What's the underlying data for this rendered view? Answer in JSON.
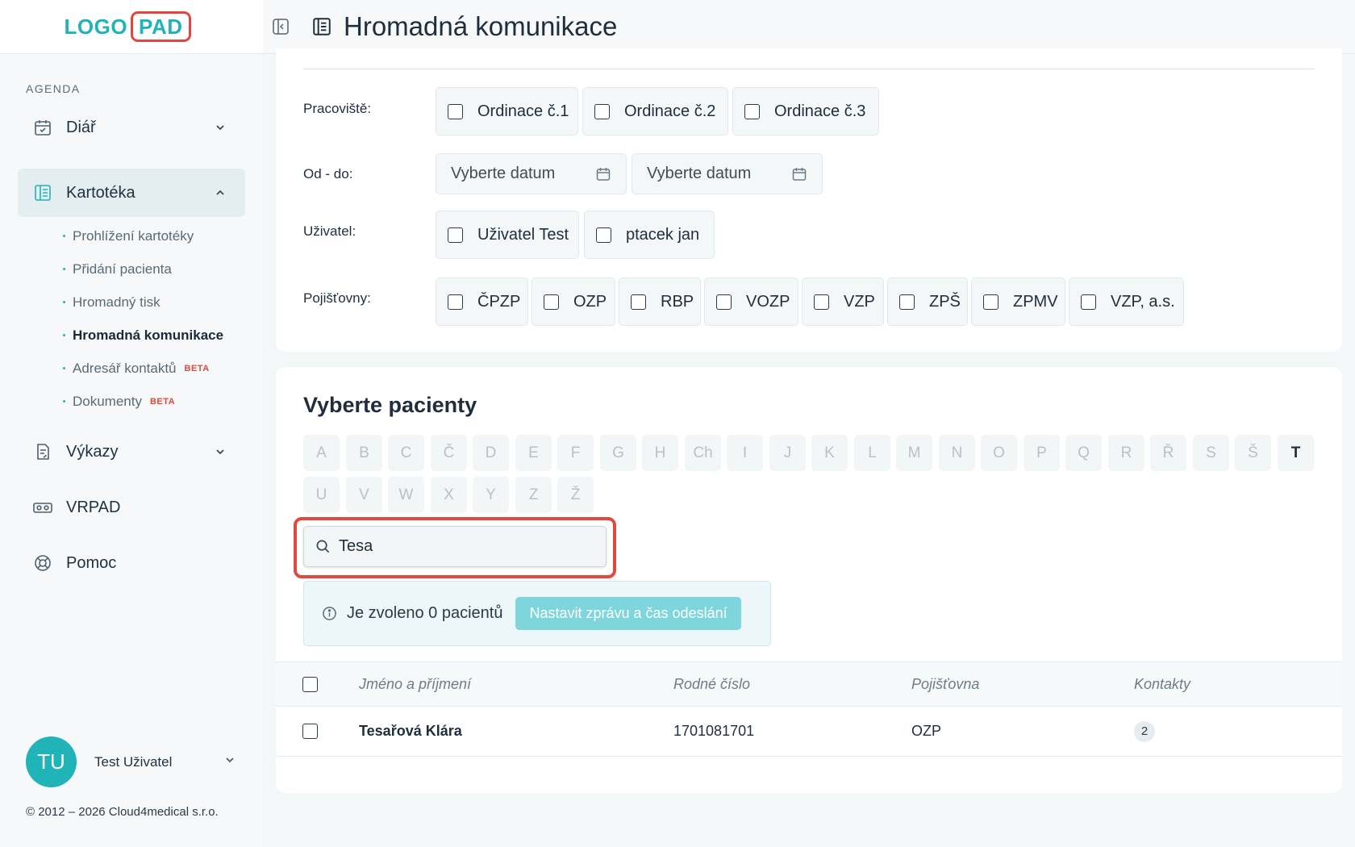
{
  "sidebar": {
    "logo": {
      "part_a": "LOGO",
      "part_b": "PAD"
    },
    "section_label": "AGENDA",
    "items": [
      {
        "label": "Diář",
        "icon": "calendar-check-icon"
      },
      {
        "label": "Kartotéka",
        "icon": "file-index-icon"
      },
      {
        "label": "Výkazy",
        "icon": "report-icon"
      },
      {
        "label": "VRPAD",
        "icon": "vr-headset-icon"
      },
      {
        "label": "Pomoc",
        "icon": "lifebuoy-icon"
      }
    ],
    "subitems": [
      {
        "label": "Prohlížení kartotéky"
      },
      {
        "label": "Přidání pacienta"
      },
      {
        "label": "Hromadný tisk"
      },
      {
        "label": "Hromadná komunikace"
      },
      {
        "label": "Adresář kontaktů",
        "badge": "BETA"
      },
      {
        "label": "Dokumenty",
        "badge": "BETA"
      }
    ],
    "user": {
      "initials": "TU",
      "name": "Test Uživatel"
    },
    "copyright": "© 2012 – 2026 Cloud4medical s.r.o."
  },
  "header": {
    "title": "Hromadná komunikace"
  },
  "filters": {
    "workplace": {
      "label": "Pracoviště:",
      "options": [
        "Ordinace č.1",
        "Ordinace č.2",
        "Ordinace č.3"
      ]
    },
    "date": {
      "label": "Od - do:",
      "from_placeholder": "Vyberte datum",
      "to_placeholder": "Vyberte datum"
    },
    "user": {
      "label": "Uživatel:",
      "options": [
        "Uživatel Test",
        "ptacek jan"
      ]
    },
    "insurance": {
      "label": "Pojišťovny:",
      "options": [
        "ČPZP",
        "OZP",
        "RBP",
        "VOZP",
        "VZP",
        "ZPŠ",
        "ZPMV",
        "VZP, a.s."
      ]
    }
  },
  "patients": {
    "title": "Vyberte pacienty",
    "letters_row1": [
      "A",
      "B",
      "C",
      "Č",
      "D",
      "E",
      "F",
      "G",
      "H",
      "Ch",
      "I",
      "J",
      "K",
      "L",
      "M",
      "N",
      "O",
      "P",
      "Q",
      "R",
      "Ř",
      "S",
      "Š",
      "T"
    ],
    "letters_row2": [
      "U",
      "V",
      "W",
      "X",
      "Y",
      "Z",
      "Ž"
    ],
    "active_letter": "T",
    "search_value": "Tesa",
    "info_text": "Je zvoleno 0 pacientů",
    "action_button": "Nastavit zprávu a čas odeslání",
    "columns": [
      "Jméno a příjmení",
      "Rodné číslo",
      "Pojišťovna",
      "Kontakty"
    ],
    "rows": [
      {
        "name": "Tesařová Klára",
        "birth_number": "1701081701",
        "insurance": "OZP",
        "contacts": "2"
      }
    ]
  }
}
